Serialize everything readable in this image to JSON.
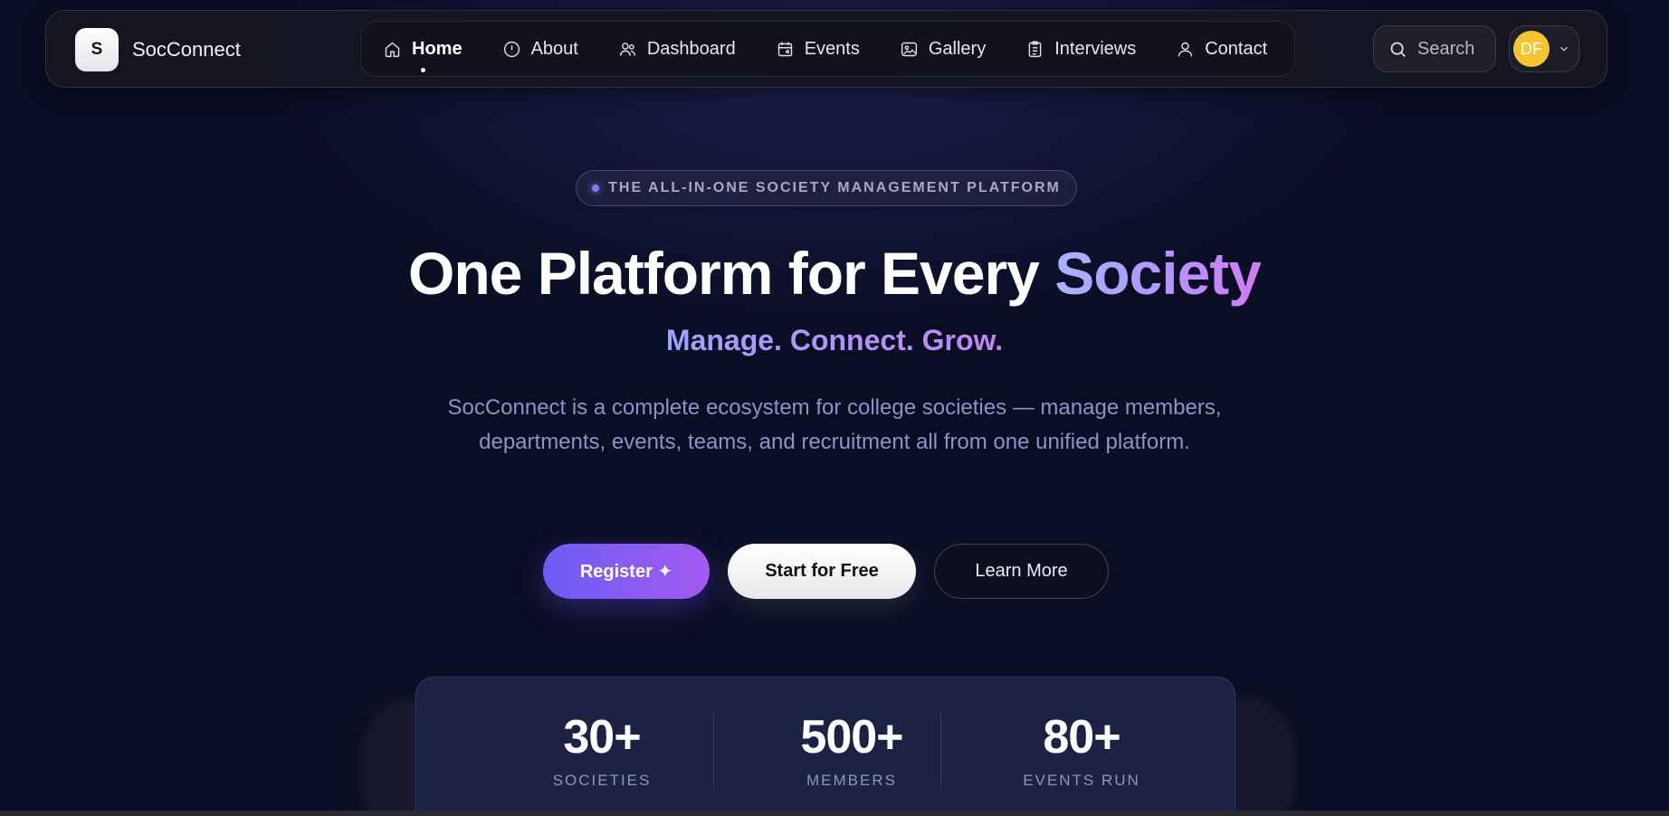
{
  "brand": {
    "logo_letter": "S",
    "name": "SocConnect"
  },
  "nav": {
    "items": [
      {
        "label": "Home",
        "icon": "home-icon",
        "active": true
      },
      {
        "label": "About",
        "icon": "info-icon"
      },
      {
        "label": "Dashboard",
        "icon": "users-icon"
      },
      {
        "label": "Events",
        "icon": "calendar-icon"
      },
      {
        "label": "Gallery",
        "icon": "image-icon"
      },
      {
        "label": "Interviews",
        "icon": "clipboard-icon"
      },
      {
        "label": "Contact",
        "icon": "user-icon"
      }
    ]
  },
  "search": {
    "label": "Search",
    "icon": "search-icon"
  },
  "profile": {
    "initials": "DF",
    "avatar_color": "#f5c52e"
  },
  "hero": {
    "badge": "THE ALL-IN-ONE SOCIETY MANAGEMENT PLATFORM",
    "title_main": "One Platform for Every ",
    "title_accent": "Society",
    "subtitle": "Manage. Connect. Grow.",
    "description": "SocConnect is a complete ecosystem for college societies — manage members, departments, events, teams, and recruitment all from one unified platform."
  },
  "buttons": {
    "register": "Register ✦",
    "start_free": "Start for Free",
    "learn_more": "Learn More"
  },
  "stats": [
    {
      "value": "30+",
      "label": "SOCIETIES"
    },
    {
      "value": "500+",
      "label": "MEMBERS"
    },
    {
      "value": "80+",
      "label": "EVENTS RUN"
    }
  ],
  "colors": {
    "background": "#0a0e24",
    "accent_purple": "#6c5cf4",
    "accent_violet": "#a35bf0",
    "text_muted": "#8a95c6"
  }
}
